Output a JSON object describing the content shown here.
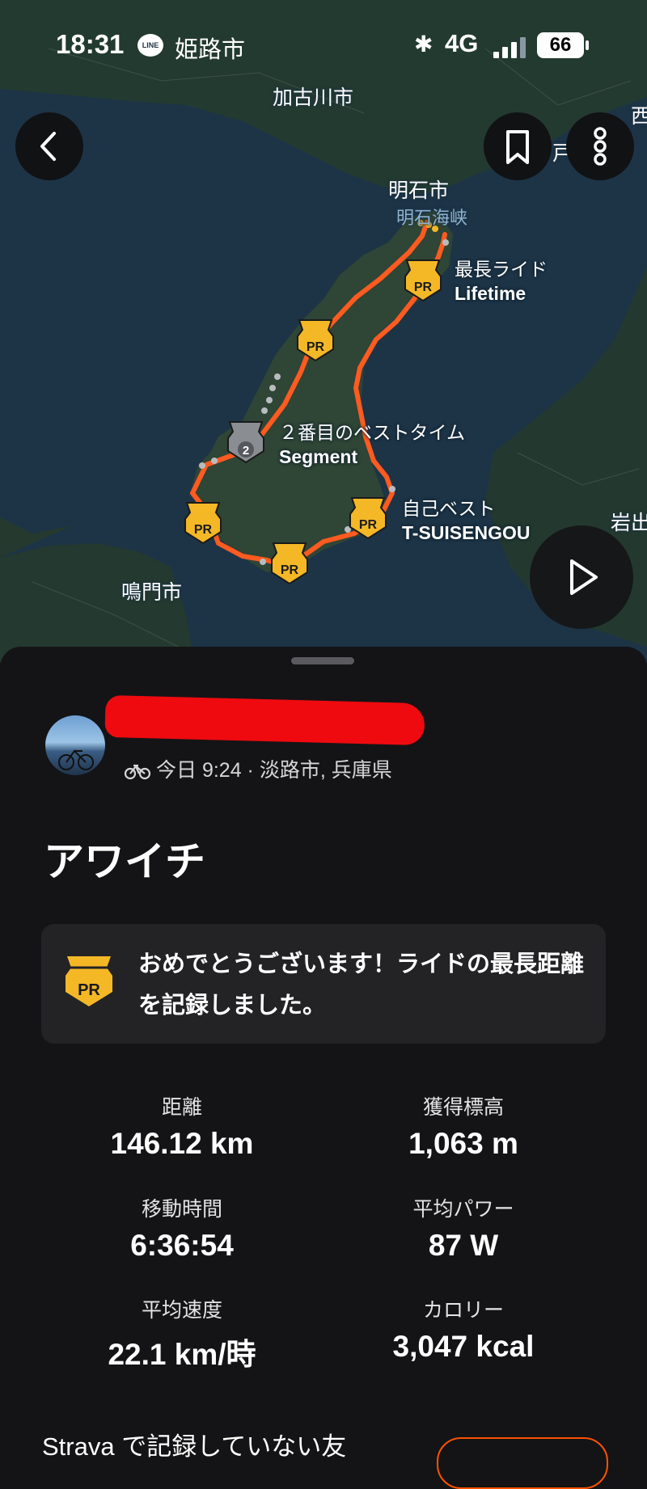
{
  "status_bar": {
    "time": "18:31",
    "line_badge": "LINE",
    "location": "姫路市",
    "network": "4G",
    "battery": "66"
  },
  "map": {
    "labels": [
      "加古川市",
      "明石市",
      "明石海峡",
      "鳴門市",
      "岩出",
      "西",
      "戸"
    ],
    "pins": [
      {
        "badge": "PR",
        "title": "最長ライド",
        "subtitle": "Lifetime"
      },
      {
        "badge": "2",
        "title": "２番目のベストタイム",
        "subtitle": "Segment"
      },
      {
        "badge": "PR",
        "title": "自己ベスト",
        "subtitle": "T-SUISENGOU"
      },
      {
        "badge": "PR"
      },
      {
        "badge": "PR"
      },
      {
        "badge": "PR"
      }
    ],
    "route_color": "#ff5a1f",
    "pin_color": "#f4b826"
  },
  "activity": {
    "meta": "今日 9:24 · 淡路市, 兵庫県",
    "title": "アワイチ",
    "achievement": {
      "badge": "PR",
      "message": "おめでとうございます！ライドの最長距離を記録しました。"
    },
    "stats": [
      {
        "label": "距離",
        "value": "146.12 km"
      },
      {
        "label": "獲得標高",
        "value": "1,063 m"
      },
      {
        "label": "移動時間",
        "value": "6:36:54"
      },
      {
        "label": "平均パワー",
        "value": "87 W"
      },
      {
        "label": "平均速度",
        "value": "22.1 km/時"
      },
      {
        "label": "カロリー",
        "value": "3,047 kcal"
      }
    ]
  },
  "footer": {
    "text": "Strava で記録していない友"
  },
  "colors": {
    "accent": "#fc5200",
    "sheet_bg": "#141416",
    "card_bg": "#232326"
  }
}
